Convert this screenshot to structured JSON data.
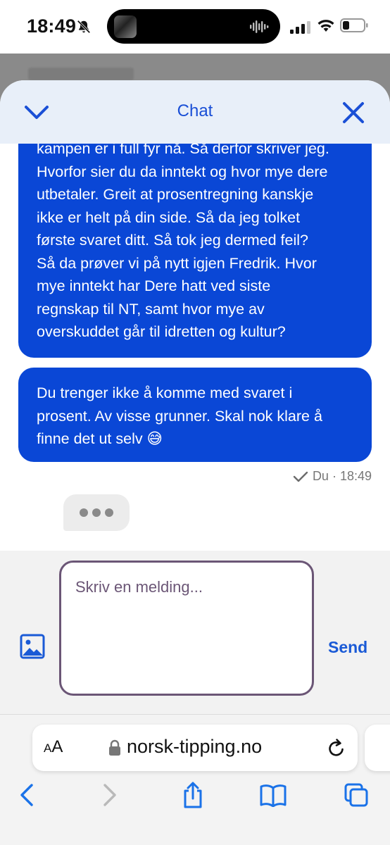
{
  "status_bar": {
    "time": "18:49"
  },
  "chat": {
    "title": "Chat",
    "messages": [
      {
        "lines": [
          "kampen er i full fyr nå. Så derfor skriver jeg.",
          "Hvorfor sier du da inntekt og hvor mye dere",
          "utbetaler. Greit at prosentregning kanskje",
          "ikke er helt på din side. Så da jeg tolket",
          "første svaret ditt. Så tok jeg dermed feil?",
          "Så da prøver vi på nytt igjen Fredrik. Hvor",
          "mye inntekt har Dere hatt ved siste",
          "regnskap til NT, samt hvor mye av",
          "overskuddet går til idretten og kultur?"
        ]
      },
      {
        "lines": [
          "Du trenger ikke å komme med svaret i",
          "prosent. Av visse grunner. Skal nok klare å",
          "finne det ut selv 😅"
        ]
      }
    ],
    "meta": "Du · 18:49",
    "composer": {
      "placeholder": "Skriv en melding...",
      "send_label": "Send"
    }
  },
  "browser": {
    "aa_label_big": "A",
    "aa_label_small": "A",
    "url": "norsk-tipping.no"
  },
  "colors": {
    "bubble": "#0a47d6",
    "header_bg": "#e8eff9",
    "accent": "#1a4fd6",
    "composer_border": "#6b5676"
  }
}
